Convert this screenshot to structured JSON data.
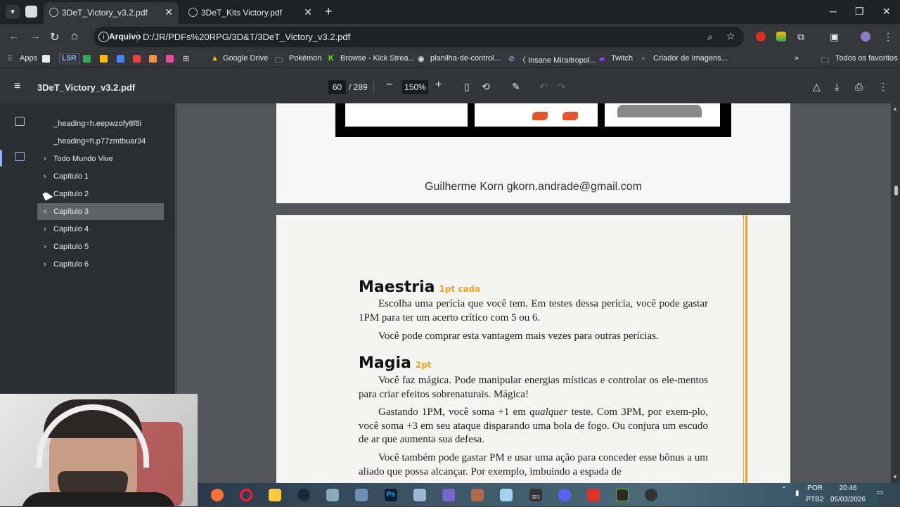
{
  "browser": {
    "tabs": [
      {
        "title": "3DeT_Victory_v3.2.pdf",
        "active": true
      },
      {
        "title": "3DeT_Kits Victory.pdf",
        "active": false
      }
    ],
    "address": {
      "scheme_label": "Arquivo",
      "url": "D:/JR/PDFs%20RPG/3D&T/3DeT_Victory_v3.2.pdf"
    },
    "bookmarks": [
      "Apps",
      "L5R",
      "Google Drive",
      "Pokémon",
      "Browse - Kick Strea...",
      "planilha-de-control...",
      "〈 Insane Miraitropol...",
      "Twitch",
      "Criador de Imagens...",
      "Todos os favoritos"
    ]
  },
  "pdf": {
    "title": "3DeT_Victory_v3.2.pdf",
    "current_page": "60",
    "total_pages": "/ 289",
    "zoom": "150%",
    "outline": [
      {
        "label": "_heading=h.eepwzofy8f8i",
        "chevron": false,
        "selected": false
      },
      {
        "label": "_heading=h.p77zmtbuar34",
        "chevron": false,
        "selected": false
      },
      {
        "label": "Todo Mundo Vive",
        "chevron": true,
        "selected": false
      },
      {
        "label": "Capítulo 1",
        "chevron": true,
        "selected": false
      },
      {
        "label": "Capítulo 2",
        "chevron": true,
        "selected": false
      },
      {
        "label": "Capítulo 3",
        "chevron": true,
        "selected": true
      },
      {
        "label": "Capítulo 4",
        "chevron": true,
        "selected": false
      },
      {
        "label": "Capítulo 5",
        "chevron": true,
        "selected": false
      },
      {
        "label": "Capítulo 6",
        "chevron": true,
        "selected": false
      }
    ],
    "page1": {
      "author": "Guilherme Korn gkorn.andrade@gmail.com"
    },
    "page2": {
      "maestria_title": "Maestria",
      "maestria_cost": "1pt cada",
      "maestria_p1": "Escolha uma perícia que você tem. Em testes dessa perícia, você pode gastar 1PM para ter um acerto crítico com 5 ou 6.",
      "maestria_p2": "Você pode comprar esta vantagem mais vezes para outras perícias.",
      "magia_title": "Magia",
      "magia_cost": "2pt",
      "magia_p1": "Você faz mágica. Pode manipular energias místicas e controlar os ele-mentos para criar efeitos sobrenaturais. Mágica!",
      "magia_p2_a": "Gastando 1PM, você soma +1 em ",
      "magia_p2_em": "qualquer",
      "magia_p2_b": " teste. Com 3PM, por exem-plo, você soma +3 em seu ataque disparando uma bola de fogo. Ou conjura um escudo de ar que aumenta sua defesa.",
      "magia_p3": "Você também pode gastar PM e usar uma ação para conceder esse bônus a um aliado que possa alcançar. Por exemplo, imbuindo a espada de"
    }
  },
  "taskbar": {
    "lang_top": "POR",
    "lang_bottom": "PTB2",
    "time": "20:46",
    "date": "05/03/2026",
    "badge": "321"
  },
  "colors": {
    "accent_orange": "#f3a325",
    "selection_blue": "#8ab4f8"
  }
}
